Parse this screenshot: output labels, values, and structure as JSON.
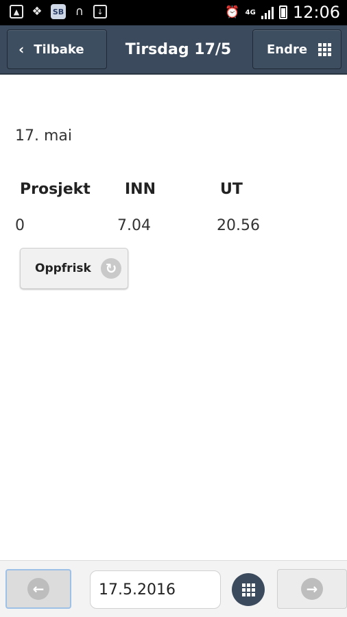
{
  "status_bar": {
    "time": "12:06",
    "network": "4G",
    "left_icons": [
      "gallery-icon",
      "dropbox-icon",
      "app-icon",
      "headset-icon",
      "download-icon"
    ],
    "right_icons": [
      "alarm-icon",
      "signal-icon",
      "battery-icon"
    ],
    "app_icon_text": "SB"
  },
  "header": {
    "back_label": "Tilbake",
    "title": "Tirsdag 17/5",
    "edit_label": "Endre",
    "color": "#3b4a5c"
  },
  "main": {
    "date_heading": "17. mai",
    "columns": [
      "Prosjekt",
      "INN",
      "UT"
    ],
    "rows": [
      [
        "0",
        "7.04",
        "20.56"
      ]
    ],
    "refresh_label": "Oppfrisk"
  },
  "bottom_bar": {
    "date_value": "17.5.2016"
  }
}
